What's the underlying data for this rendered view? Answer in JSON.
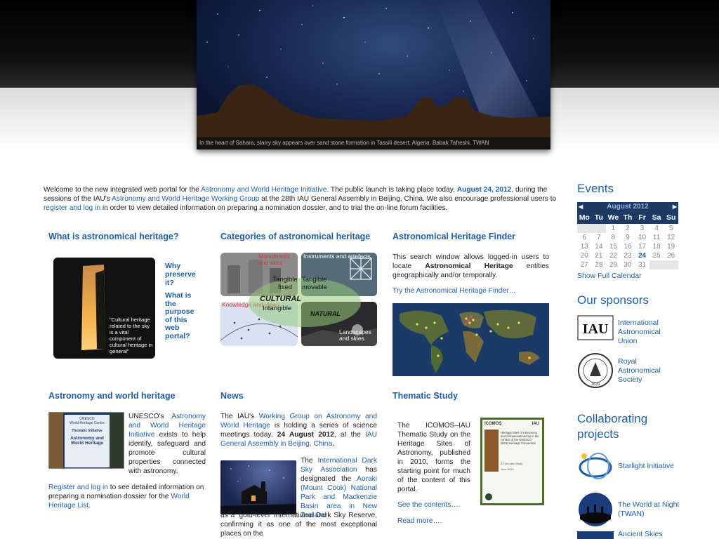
{
  "hero": {
    "caption": "In the heart of Sahara, starry sky appears over sand stone formation in Tassili desert, Algeria. Babak Tafreshi, TWAN"
  },
  "intro": {
    "t1": "Welcome to the new integrated web portal for the ",
    "l1": "Astronomy and World Heritage Initiative",
    "t2": ". The public launch is taking place today, ",
    "date": "August 24, 2012",
    "t3": ", during the sessions of the IAU's ",
    "l2": "Astronomy and World Heritage Working Group",
    "t4": " at the 28th IAU General Assembly in Beijing, China. We also encourage professional users to ",
    "l3": "register and log in",
    "t5": " in order to view detailed information on preparing a nomination dossier, and to trial the on-line forum facilities."
  },
  "heritage": {
    "title": "What is astronomical heritage?",
    "quote": "\"Cultural heritage related to the sky is a vital component of cultural heritage in general\"",
    "link1": "Why preserve it?",
    "link2": "What is the purpose of this web portal?"
  },
  "categories": {
    "title": "Categories of astronomical heritage",
    "monuments": "Monuments and sites",
    "instruments": "Instruments and artefacts",
    "knowledge": "Knowledge and ideas",
    "landscapes": "Landscapes and skies",
    "tangible_fixed": "Tangible fixed",
    "tangible_movable": "Tangible movable",
    "cultural": "CULTURAL",
    "intangible": "Intangible",
    "natural": "NATURAL"
  },
  "finder": {
    "title": "Astronomical Heritage Finder",
    "text1": "This search window allows logged-in users to locate ",
    "bold": "Astronomical Heritage",
    "text2": " entities geographically and/or temporally.",
    "link": "Try the Astronomical Heritage Finder…"
  },
  "worldheritage": {
    "title": "Astronomy and world heritage",
    "cover_line1": "UNESCO",
    "cover_line2": "World Heritage Centre",
    "cover_line3": "Thematic Initiative",
    "cover_line4": "Astronomy and World Heritage",
    "t1": "UNESCO's ",
    "l1": "Astronomy and World Heritage Initiative",
    "t2": " exists to help identify, safeguard and promote cultural properties connected with astronomy.",
    "l2": "Register and log in",
    "t3": " to see detailed information on preparing a nomination dossier for the ",
    "l3": "World Heritage List",
    "t4": "."
  },
  "news": {
    "title": "News",
    "t1": "The IAU's ",
    "l1": "Working Group on Astronomy and World Heritage",
    "t2": " is holding a series of science meetings today, ",
    "b1": "24 August 2012",
    "t3": ", at the ",
    "l2": "IAU General Assembly in Beijing, China",
    "t4": ".",
    "t5": "The ",
    "l3": "International Dark Sky Association",
    "t6": " has designated the ",
    "l4": "Aoraki (Mount Cook) National Park and Mackenzie Basin area in New Zealand",
    "t7": " as a ‘gold-level’ International Dark Sky Reserve, confirming it as one of the most exceptional places on the"
  },
  "thematic": {
    "title": "Thematic Study",
    "text": "The ICOMOS–IAU Thematic Study on the Heritage Sites of Astronomy, published in 2010, forms the starting point for much of the content of this portal.",
    "link1": "See the contents….",
    "link2": "Read more….",
    "cover_brand": "ICOMOS",
    "cover_iau": "IAU",
    "cover_title": "Heritage Sites of Astronomy and Archaeoastronomy in the context of the UNESCO World Heritage Convention",
    "cover_sub": "A Thematic Study",
    "cover_date": "June 2010"
  },
  "events": {
    "title": "Events",
    "month": "August 2012",
    "prev": "◀",
    "next": "▶",
    "dow": [
      "Mo",
      "Tu",
      "We",
      "Th",
      "Fr",
      "Sa",
      "Su"
    ],
    "weeks": [
      [
        "",
        "",
        "1",
        "2",
        "3",
        "4",
        "5"
      ],
      [
        "6",
        "7",
        "8",
        "9",
        "10",
        "11",
        "12"
      ],
      [
        "13",
        "14",
        "15",
        "16",
        "17",
        "18",
        "19"
      ],
      [
        "20",
        "21",
        "22",
        "23",
        "24",
        "25",
        "26"
      ],
      [
        "27",
        "28",
        "29",
        "30",
        "31",
        "",
        ""
      ]
    ],
    "today": "24",
    "full_link": "Show Full Calendar"
  },
  "sponsors": {
    "title": "Our sponsors",
    "iau_logo": "IAU",
    "iau": "International Astronomical Union",
    "ras_year": "1820",
    "ras": "Royal Astronomical Society"
  },
  "projects": {
    "title": "Collaborating projects",
    "starlight": "Starlight Initiative",
    "twan": "The World at Night (TWAN)",
    "ancient": "Ancient Skies"
  }
}
